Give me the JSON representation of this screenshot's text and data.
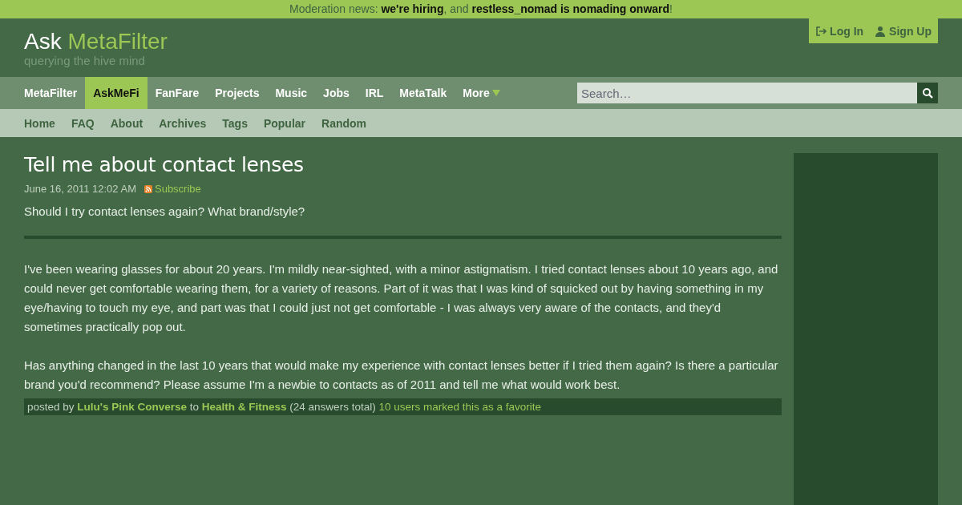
{
  "banner": {
    "parts": [
      {
        "kind": "text",
        "text": "Moderation news: "
      },
      {
        "kind": "link",
        "text": "we're hiring"
      },
      {
        "kind": "text",
        "text": ", and "
      },
      {
        "kind": "link",
        "text": "restless_nomad is nomading onward"
      },
      {
        "kind": "text",
        "text": "!"
      }
    ]
  },
  "header": {
    "site_prefix": "Ask",
    "site_name": "MetaFilter",
    "tagline": "querying the hive mind",
    "account": [
      {
        "kind": "login",
        "label": "Log In"
      },
      {
        "kind": "signup",
        "label": "Sign Up"
      }
    ]
  },
  "nav": {
    "items": [
      {
        "label": "MetaFilter",
        "selected": false
      },
      {
        "label": "AskMeFi",
        "selected": true
      },
      {
        "label": "FanFare",
        "selected": false
      },
      {
        "label": "Projects",
        "selected": false
      },
      {
        "label": "Music",
        "selected": false
      },
      {
        "label": "Jobs",
        "selected": false
      },
      {
        "label": "IRL",
        "selected": false
      },
      {
        "label": "MetaTalk",
        "selected": false
      },
      {
        "label": "More",
        "selected": false,
        "kind": "menu"
      }
    ],
    "search": {
      "placeholder": "Search…"
    }
  },
  "subnav": {
    "items": [
      "Home",
      "FAQ",
      "About",
      "Archives",
      "Tags",
      "Popular",
      "Random"
    ]
  },
  "post": {
    "title": "Tell me about contact lenses",
    "date": "June 16, 2011 12:02 AM",
    "subscribe": "Subscribe",
    "summary": "Should I try contact lenses again? What brand/style?",
    "paragraphs": [
      "I've been wearing glasses for about 20 years. I'm mildly near-sighted, with a minor astigmatism. I tried contact lenses about 10 years ago, and could never get comfortable wearing them, for a variety of reasons. Part of it was that I was kind of squicked out by having something in my eye/having to touch my eye, and part was that I could just not get comfortable - I was always very aware of the contacts, and they'd sometimes practically pop out.",
      "Has anything changed in the last 10 years that would make my experience with contact lenses better if I tried them again? Is there a particular brand you'd recommend? Please assume I'm a newbie to contacts as of 2011 and tell me what would work best."
    ],
    "byline": {
      "posted_by": "posted by",
      "author": "Lulu's Pink Converse",
      "to": "to",
      "category": "Health & Fitness",
      "answers": "(24 answers total)",
      "favorites": "10 users marked this as a favorite"
    }
  }
}
